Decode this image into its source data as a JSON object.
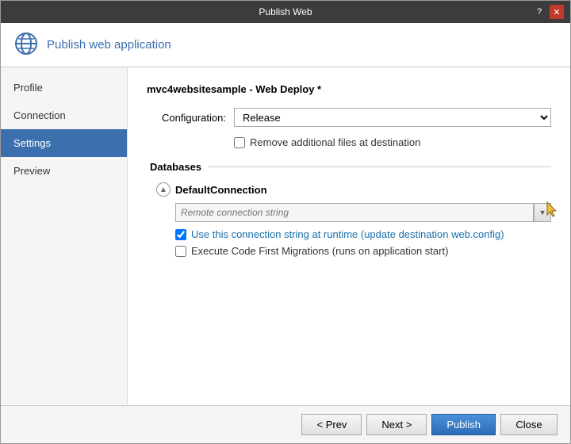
{
  "window": {
    "title": "Publish Web",
    "help_btn": "?",
    "close_btn": "✕"
  },
  "header": {
    "icon_label": "globe-icon",
    "title": "Publish web application"
  },
  "sidebar": {
    "items": [
      {
        "id": "profile",
        "label": "Profile",
        "active": false
      },
      {
        "id": "connection",
        "label": "Connection",
        "active": false
      },
      {
        "id": "settings",
        "label": "Settings",
        "active": true
      },
      {
        "id": "preview",
        "label": "Preview",
        "active": false
      }
    ]
  },
  "main": {
    "section_title": "mvc4websitesample - Web Deploy *",
    "configuration_label": "Configuration:",
    "configuration_value": "Release",
    "remove_files_label": "Remove additional files at destination",
    "databases_heading": "Databases",
    "default_connection": {
      "name": "DefaultConnection",
      "placeholder": "Remote connection string",
      "use_connection_string": "Use this connection string at runtime (update destination web.config)",
      "execute_migrations": "Execute Code First Migrations (runs on application start)"
    }
  },
  "footer": {
    "prev_label": "< Prev",
    "next_label": "Next >",
    "publish_label": "Publish",
    "close_label": "Close"
  }
}
